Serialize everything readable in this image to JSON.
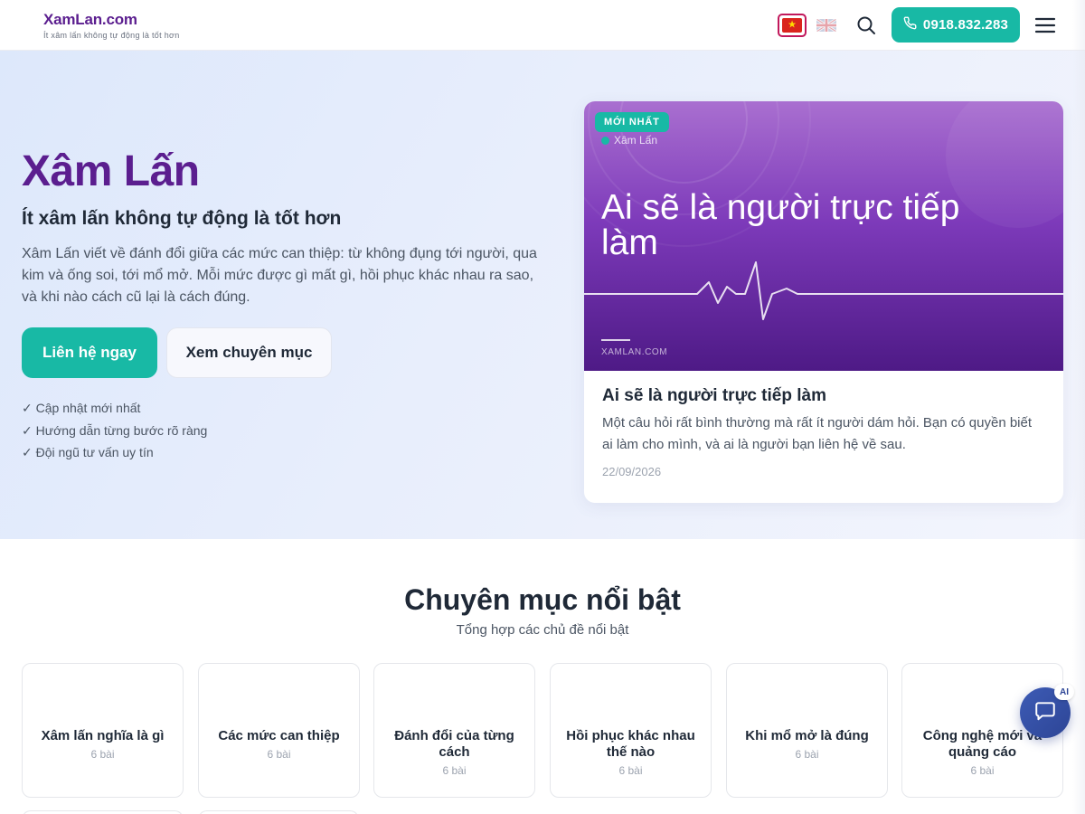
{
  "header": {
    "brand_name": "XamLan.com",
    "brand_tagline": "Ít xâm lấn không tự động là tốt hơn",
    "phone": "0918.832.283",
    "languages": [
      "vn-flag-icon",
      "uk-flag-icon"
    ],
    "icons": [
      "search-icon",
      "phone-icon",
      "hamburger-menu-icon"
    ],
    "accent_color": "#18b9a5",
    "brand_color": "#5b1e8f"
  },
  "hero": {
    "title": "Xâm Lấn",
    "subtitle": "Ít xâm lấn không tự động là tốt hơn",
    "description": "Xâm Lấn viết về đánh đổi giữa các mức can thiệp: từ không đụng tới người, qua kim và ống soi, tới mổ mở. Mỗi mức được gì mất gì, hồi phục khác nhau ra sao, và khi nào cách cũ lại là cách đúng.",
    "primary_button": "Liên hệ ngay",
    "secondary_button": "Xem chuyên mục",
    "checklist": [
      "✓ Cập nhật mới nhất",
      "✓ Hướng dẫn từng bước rõ ràng",
      "✓ Đội ngũ tư vấn uy tín"
    ]
  },
  "featured": {
    "badge": "MỚI NHẤT",
    "image_source": "Xâm Lấn",
    "image_title": "Ai sẽ là người trực tiếp làm",
    "image_domain": "XAMLAN.COM",
    "title": "Ai sẽ là người trực tiếp làm",
    "excerpt": "Một câu hỏi rất bình thường mà rất ít người dám hỏi. Bạn có quyền biết ai làm cho mình, và ai là người bạn liên hệ về sau.",
    "date": "22/09/2026"
  },
  "categories": {
    "title": "Chuyên mục nổi bật",
    "subtitle": "Tổng hợp các chủ đề nổi bật",
    "items": [
      {
        "name": "Xâm lấn nghĩa là gì",
        "count": "6 bài"
      },
      {
        "name": "Các mức can thiệp",
        "count": "6 bài"
      },
      {
        "name": "Đánh đổi của từng cách",
        "count": "6 bài"
      },
      {
        "name": "Hồi phục khác nhau thế nào",
        "count": "6 bài"
      },
      {
        "name": "Khi mổ mở là đúng",
        "count": "6 bài"
      },
      {
        "name": "Công nghệ mới và quảng cáo",
        "count": "6 bài"
      }
    ]
  },
  "chat": {
    "badge": "AI",
    "icon": "chat-bubble-icon"
  }
}
